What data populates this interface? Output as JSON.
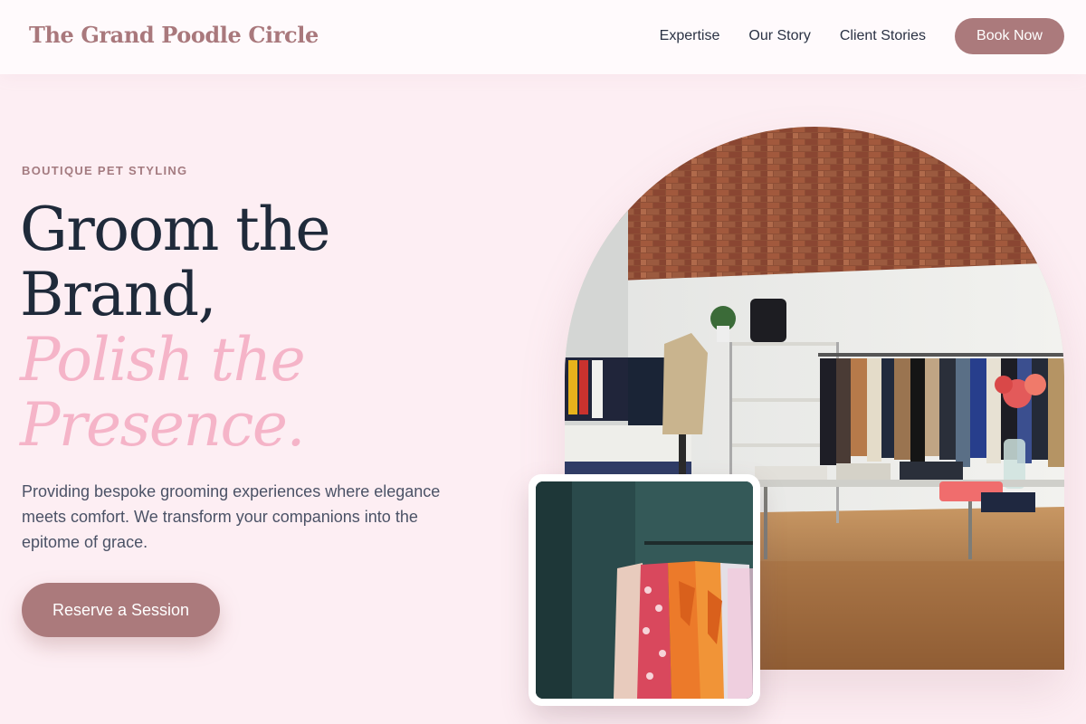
{
  "header": {
    "brand": "The Grand Poodle Circle",
    "nav": [
      {
        "label": "Expertise"
      },
      {
        "label": "Our Story"
      },
      {
        "label": "Client Stories"
      }
    ],
    "cta_label": "Book Now"
  },
  "hero": {
    "eyebrow": "BOUTIQUE PET STYLING",
    "headline_line1": "Groom the",
    "headline_line2": "Brand,",
    "headline_accent1": "Polish the",
    "headline_accent2": "Presence.",
    "description": "Providing bespoke grooming experiences where elegance meets comfort. We transform your companions into the epitome of grace.",
    "cta_label": "Reserve a Session"
  },
  "images": {
    "main": "boutique-store-interior-photo",
    "inset": "clothing-rack-photo"
  },
  "colors": {
    "background": "#fdeef3",
    "brand": "#a9787c",
    "button": "#ab7a7c",
    "accent_pink": "#f5b4c8",
    "heading": "#1f2a3a"
  }
}
